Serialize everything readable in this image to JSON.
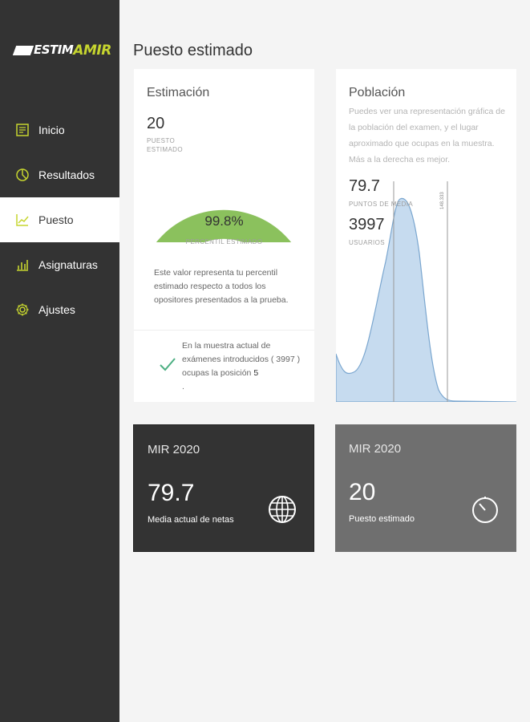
{
  "app": {
    "logo_left": "ESTIM",
    "logo_right": "AMIR"
  },
  "sidebar": {
    "items": [
      {
        "label": "Inicio",
        "icon": "home-icon"
      },
      {
        "label": "Resultados",
        "icon": "pie-chart-icon"
      },
      {
        "label": "Puesto",
        "icon": "line-chart-icon",
        "active": true
      },
      {
        "label": "Asignaturas",
        "icon": "bar-chart-icon"
      },
      {
        "label": "Ajustes",
        "icon": "gear-icon"
      }
    ]
  },
  "main": {
    "title": "Puesto estimado",
    "estimation": {
      "title": "Estimación",
      "value": "20",
      "value_label": "PUESTO ESTIMADO",
      "percentile": "99.8%",
      "percentile_fraction": 0.998,
      "percentile_label": "PERCENTIL ESTIMADO",
      "description": "Este valor representa tu percentil estimado respecto a todos los opositores presentados a la prueba.",
      "note_text": "En la muestra actual de exámenes introducidos ( 3997 ) ocupas la posición",
      "note_position": "5",
      "note_end": "."
    },
    "population": {
      "title": "Población",
      "description": "Puedes ver una representación gráfica de la población del examen, y el lugar aproximado que ocupas en la muestra. Más a la derecha es mejor.",
      "mean_value": "79.7",
      "mean_label": "PUNTOS DE MEDIA",
      "users_value": "3997",
      "users_label": "USUARIOS",
      "marker_label": "148.333"
    },
    "tiles": [
      {
        "title": "MIR 2020",
        "value": "79.7",
        "label": "Media actual de netas",
        "icon": "globe-icon"
      },
      {
        "title": "MIR 2020",
        "value": "20",
        "label": "Puesto estimado",
        "icon": "stopwatch-icon"
      }
    ]
  },
  "colors": {
    "sidebar_bg": "#333333",
    "accent_green": "#8bc15d",
    "logo_green": "#c6d52f",
    "chart_fill": "#c6dbef",
    "chart_line": "#7aa6cf",
    "check_green": "#4caf82"
  }
}
